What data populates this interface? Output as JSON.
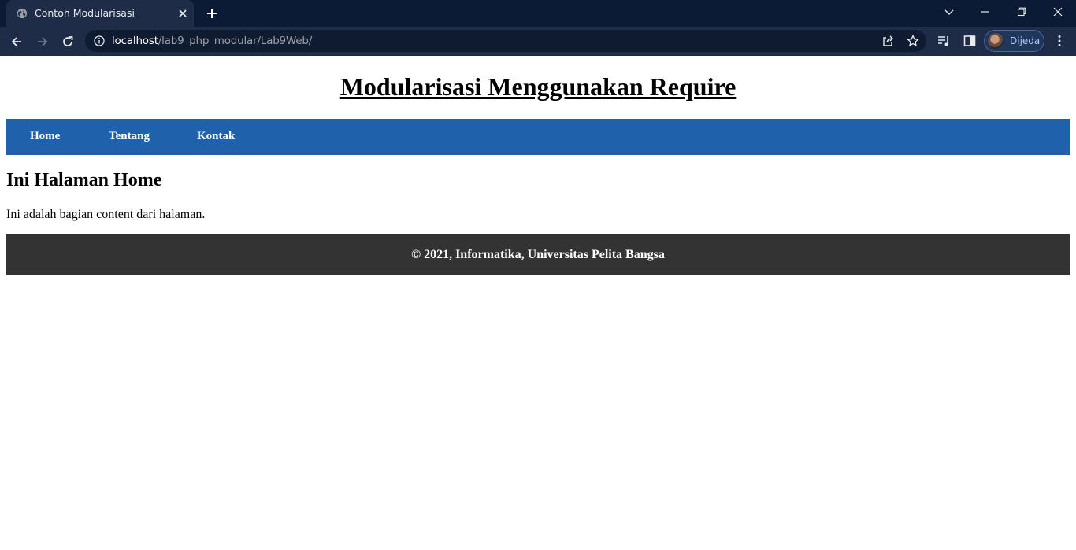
{
  "browser": {
    "tab": {
      "title": "Contoh Modularisasi",
      "favicon": "globe-icon"
    },
    "address_bar": {
      "host": "localhost",
      "path": "/lab9_php_modular/Lab9Web/"
    },
    "profile": {
      "name": "Dijeda"
    }
  },
  "page": {
    "title": "Modularisasi Menggunakan Require",
    "nav": [
      {
        "label": "Home"
      },
      {
        "label": "Tentang"
      },
      {
        "label": "Kontak"
      }
    ],
    "content": {
      "heading": "Ini Halaman Home",
      "text": "Ini adalah bagian content dari halaman."
    },
    "footer": "© 2021, Informatika, Universitas Pelita Bangsa"
  },
  "colors": {
    "chrome_tabstrip": "#0b1a35",
    "chrome_toolbar": "#1e2c47",
    "nav_background": "#1f62ab",
    "footer_background": "#333333"
  }
}
